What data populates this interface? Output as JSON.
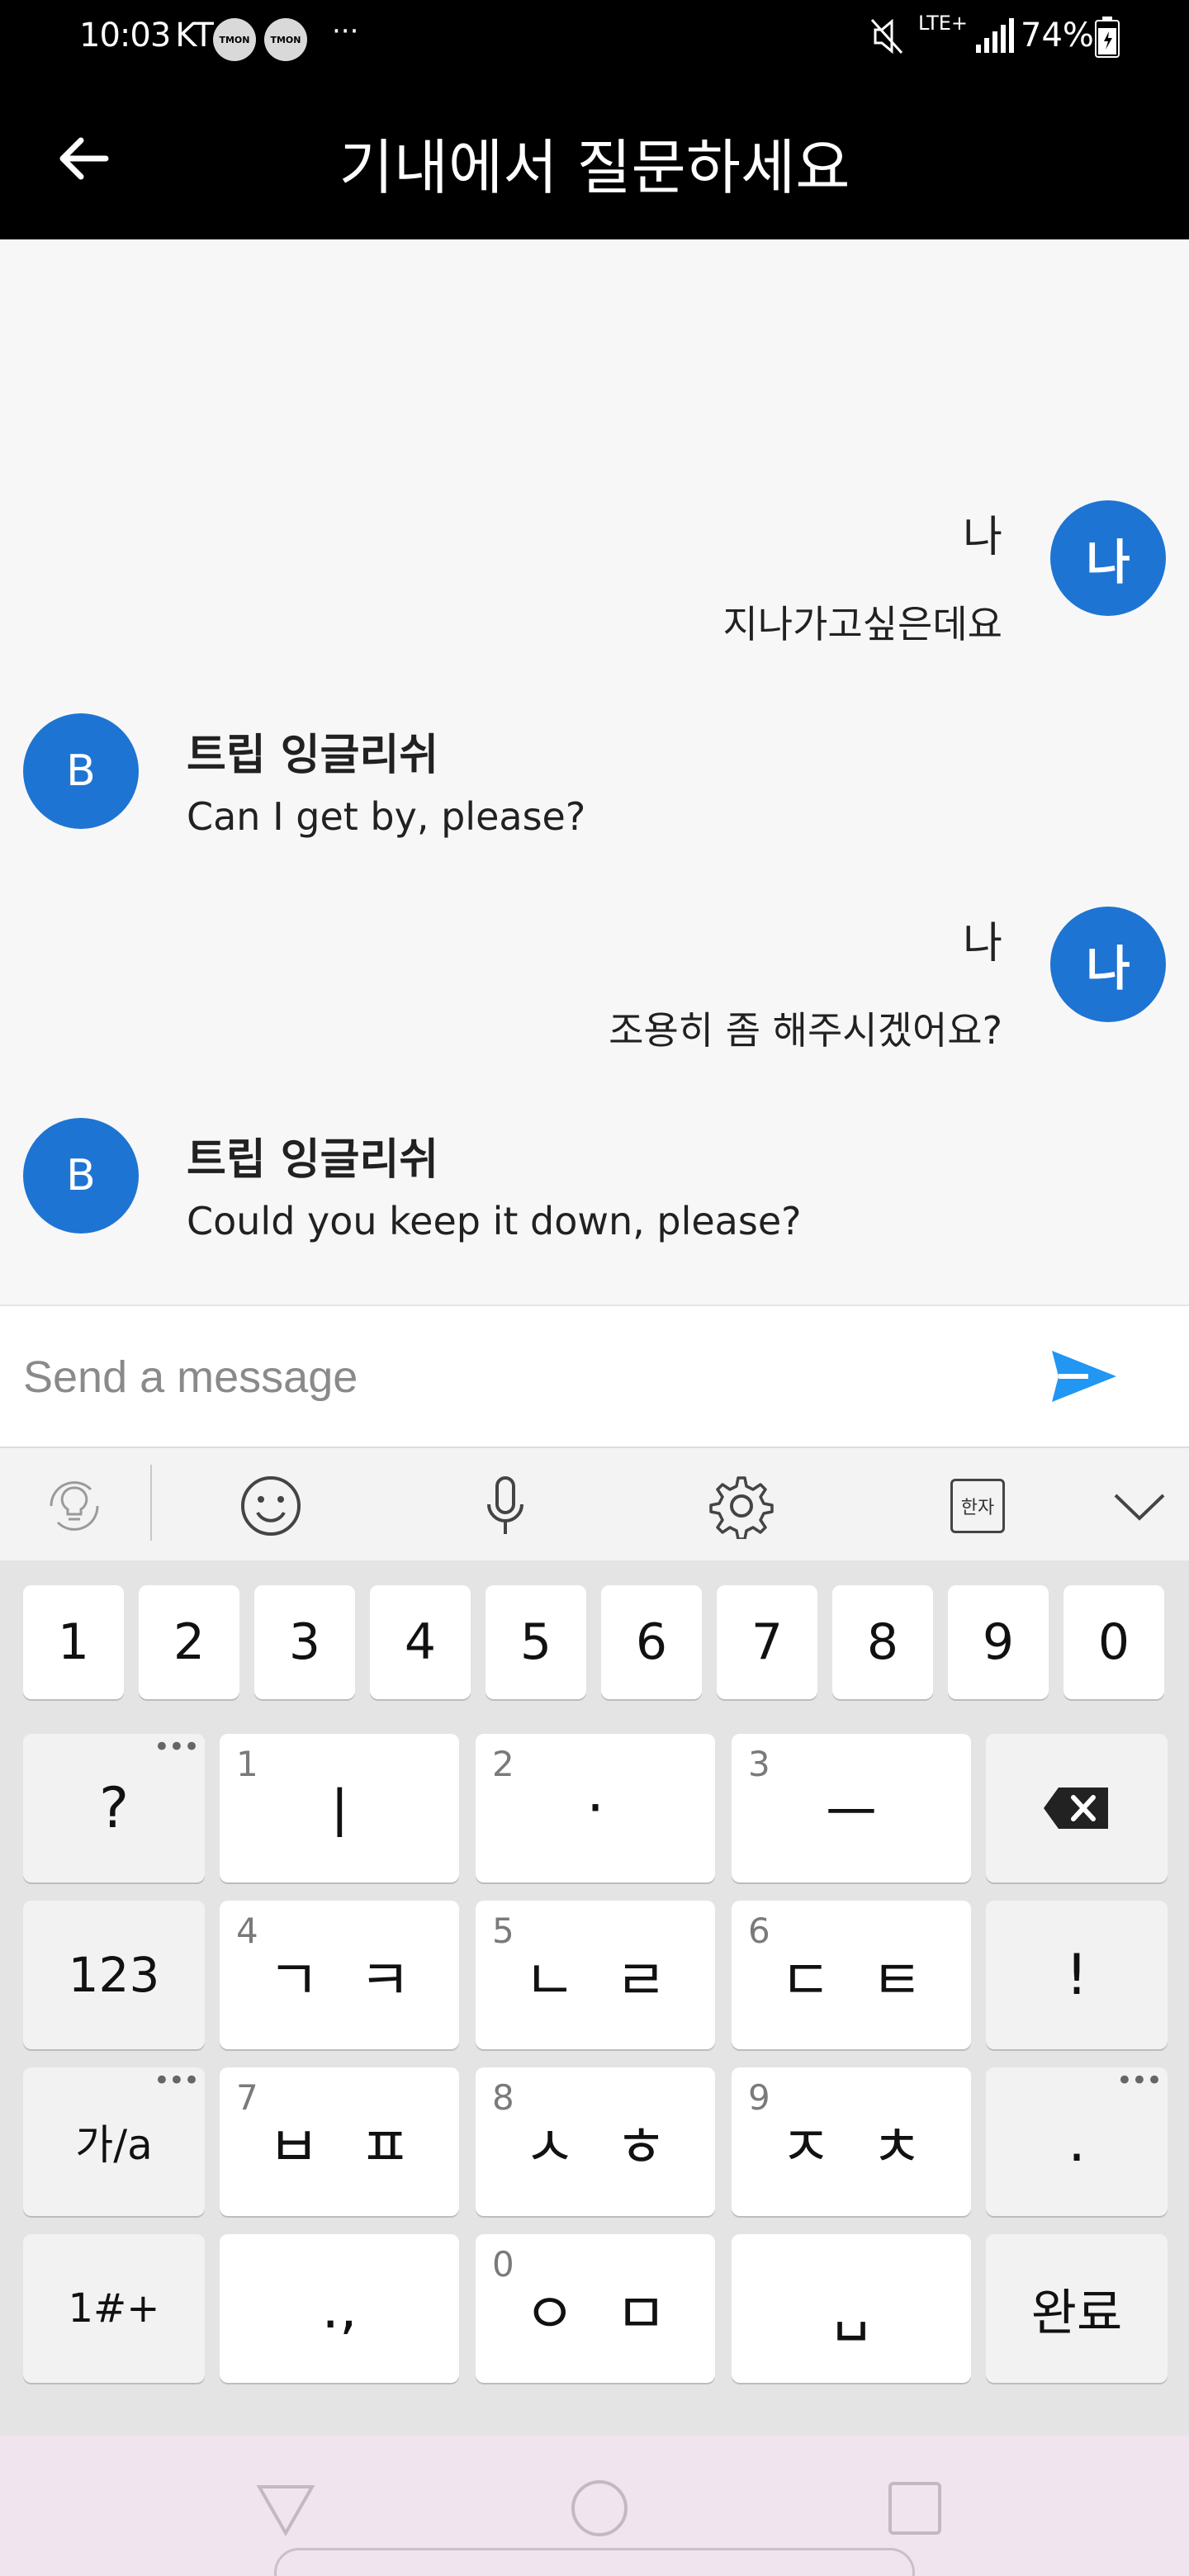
{
  "status_bar": {
    "time": "10:03",
    "carrier": "KT",
    "notification_icons": [
      "TMON",
      "TMON"
    ],
    "more": "···",
    "network": "LTE+",
    "battery": "74%"
  },
  "app_bar": {
    "title": "기내에서 질문하세요"
  },
  "messages": [
    {
      "sender": "me",
      "avatar": "나",
      "name": "나",
      "text": "지나가고싶은데요"
    },
    {
      "sender": "bot",
      "avatar": "B",
      "name": "트립 잉글리쉬",
      "text": "Can I get by, please?"
    },
    {
      "sender": "me",
      "avatar": "나",
      "name": "나",
      "text": "조용히 좀 해주시겠어요?"
    },
    {
      "sender": "bot",
      "avatar": "B",
      "name": "트립 잉글리쉬",
      "text": "Could you keep it down, please?"
    }
  ],
  "composer": {
    "placeholder": "Send a message"
  },
  "keyboard_toolbar": {
    "hanja_label": "한자"
  },
  "keyboard": {
    "number_row": [
      "1",
      "2",
      "3",
      "4",
      "5",
      "6",
      "7",
      "8",
      "9",
      "0"
    ],
    "rows": [
      {
        "left": "?",
        "keys": [
          {
            "hint": "1",
            "main": "ㅣ"
          },
          {
            "hint": "2",
            "main": "·"
          },
          {
            "hint": "3",
            "main": "ㅡ"
          }
        ],
        "right": "backspace"
      },
      {
        "left": "123",
        "keys": [
          {
            "hint": "4",
            "main": "ㄱㅋ"
          },
          {
            "hint": "5",
            "main": "ㄴㄹ"
          },
          {
            "hint": "6",
            "main": "ㄷㅌ"
          }
        ],
        "right": "!"
      },
      {
        "left": "가/a",
        "keys": [
          {
            "hint": "7",
            "main": "ㅂㅍ"
          },
          {
            "hint": "8",
            "main": "ㅅㅎ"
          },
          {
            "hint": "9",
            "main": "ㅈㅊ"
          }
        ],
        "right": "."
      },
      {
        "left": "1#+",
        "keys": [
          {
            "hint": "",
            "main": ".,"
          },
          {
            "hint": "0",
            "main": "ㅇㅁ"
          },
          {
            "hint": "",
            "main": "␣"
          }
        ],
        "right": "완료"
      }
    ]
  },
  "colors": {
    "accent": "#1e74d2",
    "send": "#2196f3",
    "app_bar": "#000000"
  }
}
